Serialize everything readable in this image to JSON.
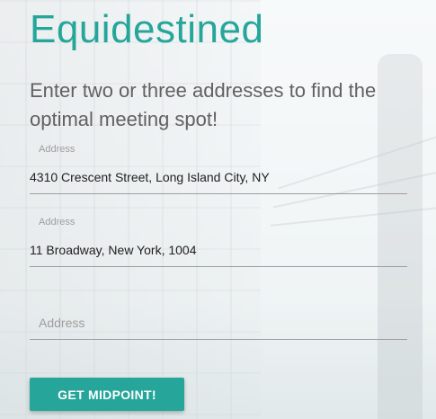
{
  "app": {
    "title": "Equidestined",
    "subtitle": "Enter two or three addresses to find the optimal meeting spot!"
  },
  "form": {
    "fields": [
      {
        "label": "Address",
        "value": "4310 Crescent Street, Long Island City, NY"
      },
      {
        "label": "Address",
        "value": "11 Broadway, New York, 1004"
      },
      {
        "placeholder": "Address",
        "value": ""
      }
    ],
    "submit_label": "GET MIDPOINT!"
  },
  "colors": {
    "accent": "#26a69a",
    "text_muted": "#616161",
    "underline": "#9e9e9e"
  }
}
